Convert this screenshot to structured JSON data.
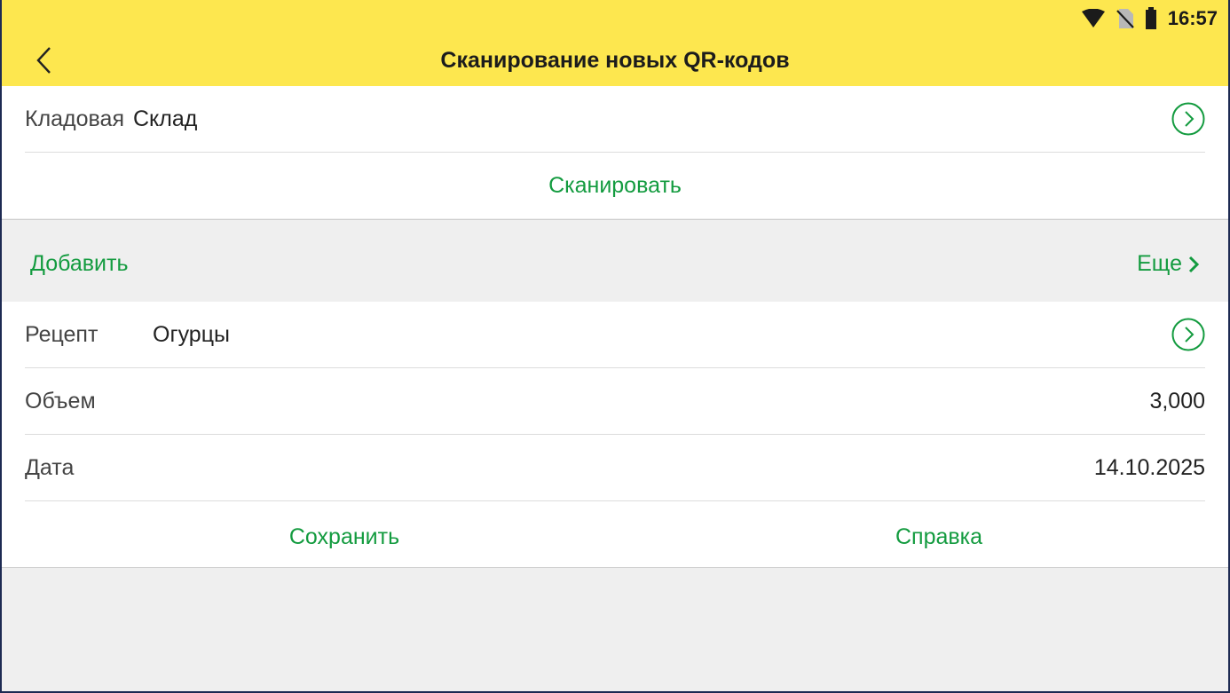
{
  "status_bar": {
    "time": "16:57",
    "icons": [
      "wifi-icon",
      "no-sim-icon",
      "battery-icon"
    ]
  },
  "header": {
    "title": "Сканирование новых QR-кодов",
    "back_icon": "chevron-left-icon"
  },
  "storage": {
    "label": "Кладовая",
    "value": "Склад",
    "scan_label": "Сканировать"
  },
  "toolbar": {
    "add_label": "Добавить",
    "more_label": "Еще"
  },
  "form": {
    "recipe_label": "Рецепт",
    "recipe_value": "Огурцы",
    "volume_label": "Объем",
    "volume_value": "3,000",
    "date_label": "Дата",
    "date_value": "14.10.2025"
  },
  "actions": {
    "save_label": "Сохранить",
    "help_label": "Справка"
  },
  "colors": {
    "appbar": "#fde74f",
    "accent": "#139b3f",
    "background": "#efefef",
    "frame": "#1d2a52"
  }
}
